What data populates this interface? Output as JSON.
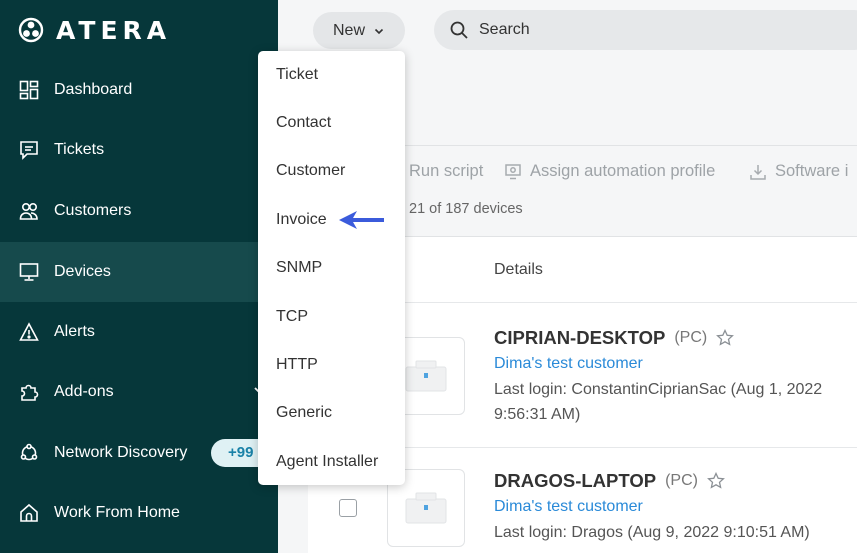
{
  "sidebar": {
    "brand": "ATERA",
    "items": [
      {
        "label": "Dashboard",
        "icon": "dashboard-icon"
      },
      {
        "label": "Tickets",
        "icon": "ticket-icon"
      },
      {
        "label": "Customers",
        "icon": "customers-icon"
      },
      {
        "label": "Devices",
        "icon": "devices-icon",
        "active": true
      },
      {
        "label": "Alerts",
        "icon": "alert-icon"
      },
      {
        "label": "Add-ons",
        "icon": "puzzle-icon"
      },
      {
        "label": "Network Discovery",
        "icon": "network-icon",
        "badge": "+99"
      },
      {
        "label": "Work From Home",
        "icon": "home-icon"
      }
    ]
  },
  "topbar": {
    "new_label": "New",
    "search_placeholder": "Search"
  },
  "dropdown": {
    "items": [
      "Ticket",
      "Contact",
      "Customer",
      "Invoice",
      "SNMP",
      "TCP",
      "HTTP",
      "Generic",
      "Agent Installer"
    ],
    "highlighted": "Invoice"
  },
  "toolbar": {
    "run_script": "Run script",
    "assign_profile": "Assign automation profile",
    "software": "Software i"
  },
  "device_count": "21 of 187 devices",
  "table": {
    "details_header": "Details",
    "rows": [
      {
        "name": "CIPRIAN-DESKTOP",
        "type": "(PC)",
        "customer": "Dima's test customer",
        "last_login": "Last login: ConstantinCiprianSac (Aug 1, 2022 9:56:31 AM)"
      },
      {
        "name": "DRAGOS-LAPTOP",
        "type": "(PC)",
        "customer": "Dima's test customer",
        "last_login": "Last login: Dragos (Aug 9, 2022 9:10:51 AM)"
      }
    ]
  },
  "colors": {
    "sidebar_bg": "#06373a",
    "sidebar_active": "#164a4c",
    "link": "#2a8ad8",
    "arrow": "#3b5bdb"
  }
}
